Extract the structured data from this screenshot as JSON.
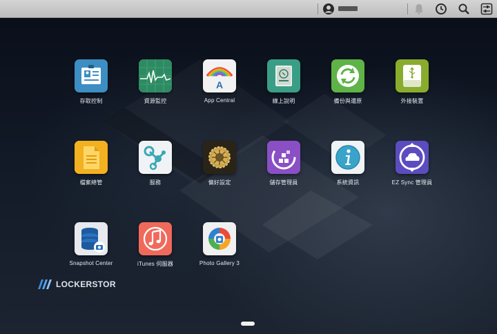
{
  "topbar": {
    "icons": [
      "user-icon",
      "notification-icon",
      "clock-icon",
      "search-icon",
      "settings-icon"
    ]
  },
  "apps": [
    {
      "label": "存取控制",
      "icon": "access-control-icon",
      "color": "#3d8ec2"
    },
    {
      "label": "資源監控",
      "icon": "resource-monitor-icon",
      "color": "#3a9a6e"
    },
    {
      "label": "App Central",
      "icon": "app-central-icon",
      "color": "#f2f2f2"
    },
    {
      "label": "線上說明",
      "icon": "online-help-icon",
      "color": "#3a9e86"
    },
    {
      "label": "備份與還原",
      "icon": "backup-restore-icon",
      "color": "#5fb347"
    },
    {
      "label": "外接裝置",
      "icon": "external-device-icon",
      "color": "#8aac2e"
    },
    {
      "label": "檔案總管",
      "icon": "file-explorer-icon",
      "color": "#f0a818"
    },
    {
      "label": "服務",
      "icon": "services-icon",
      "color": "#f0f3f5"
    },
    {
      "label": "偏好設定",
      "icon": "preferences-icon",
      "color": "#2a2418"
    },
    {
      "label": "儲存管理員",
      "icon": "storage-manager-icon",
      "color": "#8a4fc4"
    },
    {
      "label": "系統資訊",
      "icon": "system-info-icon",
      "color": "#f0f3f5"
    },
    {
      "label": "EZ Sync 管理員",
      "icon": "ez-sync-icon",
      "color": "#5b4dbf"
    },
    {
      "label": "Snapshot Center",
      "icon": "snapshot-center-icon",
      "color": "#e6eaee"
    },
    {
      "label": "iTunes 伺服器",
      "icon": "itunes-server-icon",
      "color": "#f06a5c"
    },
    {
      "label": "Photo Gallery 3",
      "icon": "photo-gallery-icon",
      "color": "#f0f0f0"
    }
  ],
  "brand": {
    "name": "LOCKERSTOR"
  }
}
